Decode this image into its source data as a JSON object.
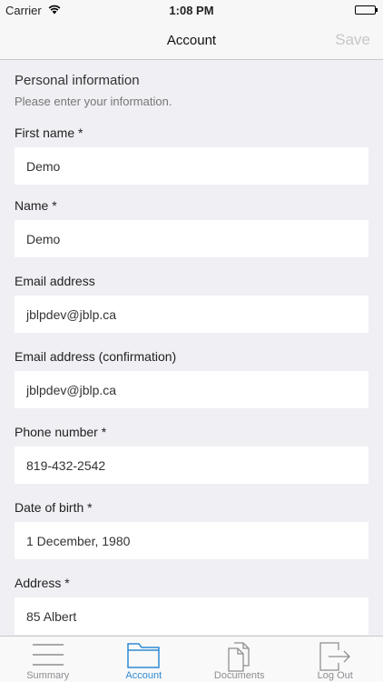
{
  "status": {
    "carrier": "Carrier",
    "time": "1:08 PM",
    "battery_level": 1.0
  },
  "nav": {
    "title": "Account",
    "save_label": "Save"
  },
  "section": {
    "title": "Personal information",
    "subtitle": "Please enter your information."
  },
  "fields": [
    {
      "label": "First name *",
      "value": "Demo"
    },
    {
      "label": "Name *",
      "value": "Demo"
    },
    {
      "label": "Email address",
      "value": "jblpdev@jblp.ca"
    },
    {
      "label": "Email address (confirmation)",
      "value": "jblpdev@jblp.ca"
    },
    {
      "label": "Phone number *",
      "value": "819-432-2542"
    },
    {
      "label": "Date of birth *",
      "value": "1 December, 1980"
    },
    {
      "label": "Address *",
      "value": "85 Albert"
    }
  ],
  "tabs": [
    {
      "label": "Summary",
      "icon": "menu-lines-icon",
      "active": false
    },
    {
      "label": "Account",
      "icon": "folder-icon",
      "active": true
    },
    {
      "label": "Documents",
      "icon": "documents-icon",
      "active": false
    },
    {
      "label": "Log Out",
      "icon": "logout-icon",
      "active": false
    }
  ],
  "colors": {
    "accent": "#2f8ad4",
    "inactive_tab": "#8e8e93",
    "background": "#efeff4",
    "disabled_save": "#c7c7cc"
  }
}
